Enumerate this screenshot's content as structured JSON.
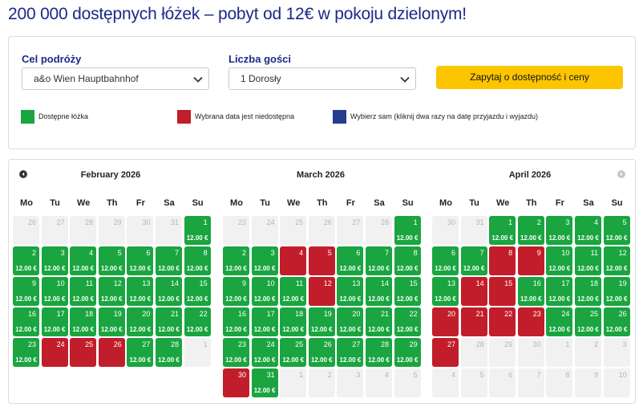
{
  "headline": "200 000 dostępnych łóżek – pobyt od 12€ w pokoju dzielonym!",
  "form": {
    "destination_label": "Cel podróży",
    "destination_value": "a&o Wien Hauptbahnhof",
    "guests_label": "Liczba gości",
    "guests_value": "1 Dorosły",
    "cta_label": "Zapytaj o dostępność i ceny"
  },
  "legend": [
    {
      "label": "Dostępne łóżka",
      "color": "#1aa540"
    },
    {
      "label": "Wybrana data jest niedostępna",
      "color": "#c21d2a"
    },
    {
      "label": "Wybierz sam (kliknij dwa razy na datę przyjazdu i wyjazdu)",
      "color": "#253c8f"
    }
  ],
  "colors": {
    "available": "#1aa540",
    "unavailable": "#c21d2a",
    "disabled": "#f1f1f1",
    "accent": "#1a2a88",
    "cta": "#fcc500"
  },
  "icons": {
    "prev": "chevron-left-icon",
    "next": "chevron-right-icon",
    "dropdown": "chevron-down-icon"
  },
  "weekdays": [
    "Mo",
    "Tu",
    "We",
    "Th",
    "Fr",
    "Sa",
    "Su"
  ],
  "price": "12.00 €",
  "months": [
    {
      "title": "February 2026",
      "cells": [
        {
          "d": "26",
          "s": "x"
        },
        {
          "d": "27",
          "s": "x"
        },
        {
          "d": "28",
          "s": "x"
        },
        {
          "d": "29",
          "s": "x"
        },
        {
          "d": "30",
          "s": "x"
        },
        {
          "d": "31",
          "s": "x"
        },
        {
          "d": "1",
          "s": "g"
        },
        {
          "d": "2",
          "s": "g"
        },
        {
          "d": "3",
          "s": "g"
        },
        {
          "d": "4",
          "s": "g"
        },
        {
          "d": "5",
          "s": "g"
        },
        {
          "d": "6",
          "s": "g"
        },
        {
          "d": "7",
          "s": "g"
        },
        {
          "d": "8",
          "s": "g"
        },
        {
          "d": "9",
          "s": "g"
        },
        {
          "d": "10",
          "s": "g"
        },
        {
          "d": "11",
          "s": "g"
        },
        {
          "d": "12",
          "s": "g"
        },
        {
          "d": "13",
          "s": "g"
        },
        {
          "d": "14",
          "s": "g"
        },
        {
          "d": "15",
          "s": "g"
        },
        {
          "d": "16",
          "s": "g"
        },
        {
          "d": "17",
          "s": "g"
        },
        {
          "d": "18",
          "s": "g"
        },
        {
          "d": "19",
          "s": "g"
        },
        {
          "d": "20",
          "s": "g"
        },
        {
          "d": "21",
          "s": "g"
        },
        {
          "d": "22",
          "s": "g"
        },
        {
          "d": "23",
          "s": "g"
        },
        {
          "d": "24",
          "s": "r"
        },
        {
          "d": "25",
          "s": "r"
        },
        {
          "d": "26",
          "s": "r"
        },
        {
          "d": "27",
          "s": "g"
        },
        {
          "d": "28",
          "s": "g"
        },
        {
          "d": "1",
          "s": "x"
        }
      ]
    },
    {
      "title": "March 2026",
      "cells": [
        {
          "d": "23",
          "s": "x"
        },
        {
          "d": "24",
          "s": "x"
        },
        {
          "d": "25",
          "s": "x"
        },
        {
          "d": "26",
          "s": "x"
        },
        {
          "d": "27",
          "s": "x"
        },
        {
          "d": "28",
          "s": "x"
        },
        {
          "d": "1",
          "s": "g"
        },
        {
          "d": "2",
          "s": "g"
        },
        {
          "d": "3",
          "s": "g"
        },
        {
          "d": "4",
          "s": "r"
        },
        {
          "d": "5",
          "s": "r"
        },
        {
          "d": "6",
          "s": "g"
        },
        {
          "d": "7",
          "s": "g"
        },
        {
          "d": "8",
          "s": "g"
        },
        {
          "d": "9",
          "s": "g"
        },
        {
          "d": "10",
          "s": "g"
        },
        {
          "d": "11",
          "s": "g"
        },
        {
          "d": "12",
          "s": "r"
        },
        {
          "d": "13",
          "s": "g"
        },
        {
          "d": "14",
          "s": "g"
        },
        {
          "d": "15",
          "s": "g"
        },
        {
          "d": "16",
          "s": "g"
        },
        {
          "d": "17",
          "s": "g"
        },
        {
          "d": "18",
          "s": "g"
        },
        {
          "d": "19",
          "s": "g"
        },
        {
          "d": "20",
          "s": "g"
        },
        {
          "d": "21",
          "s": "g"
        },
        {
          "d": "22",
          "s": "g"
        },
        {
          "d": "23",
          "s": "g"
        },
        {
          "d": "24",
          "s": "g"
        },
        {
          "d": "25",
          "s": "g"
        },
        {
          "d": "26",
          "s": "g"
        },
        {
          "d": "27",
          "s": "g"
        },
        {
          "d": "28",
          "s": "g"
        },
        {
          "d": "29",
          "s": "g"
        },
        {
          "d": "30",
          "s": "r"
        },
        {
          "d": "31",
          "s": "g"
        },
        {
          "d": "1",
          "s": "x"
        },
        {
          "d": "2",
          "s": "x"
        },
        {
          "d": "3",
          "s": "x"
        },
        {
          "d": "4",
          "s": "x"
        },
        {
          "d": "5",
          "s": "x"
        }
      ]
    },
    {
      "title": "April 2026",
      "cells": [
        {
          "d": "30",
          "s": "x"
        },
        {
          "d": "31",
          "s": "x"
        },
        {
          "d": "1",
          "s": "g"
        },
        {
          "d": "2",
          "s": "g"
        },
        {
          "d": "3",
          "s": "g"
        },
        {
          "d": "4",
          "s": "g"
        },
        {
          "d": "5",
          "s": "g"
        },
        {
          "d": "6",
          "s": "g"
        },
        {
          "d": "7",
          "s": "g"
        },
        {
          "d": "8",
          "s": "r"
        },
        {
          "d": "9",
          "s": "r"
        },
        {
          "d": "10",
          "s": "g"
        },
        {
          "d": "11",
          "s": "g"
        },
        {
          "d": "12",
          "s": "g"
        },
        {
          "d": "13",
          "s": "g"
        },
        {
          "d": "14",
          "s": "r"
        },
        {
          "d": "15",
          "s": "r"
        },
        {
          "d": "16",
          "s": "g"
        },
        {
          "d": "17",
          "s": "g"
        },
        {
          "d": "18",
          "s": "g"
        },
        {
          "d": "19",
          "s": "g"
        },
        {
          "d": "20",
          "s": "r"
        },
        {
          "d": "21",
          "s": "r"
        },
        {
          "d": "22",
          "s": "r"
        },
        {
          "d": "23",
          "s": "r"
        },
        {
          "d": "24",
          "s": "g"
        },
        {
          "d": "25",
          "s": "g"
        },
        {
          "d": "26",
          "s": "g"
        },
        {
          "d": "27",
          "s": "r"
        },
        {
          "d": "28",
          "s": "x"
        },
        {
          "d": "29",
          "s": "x"
        },
        {
          "d": "30",
          "s": "x"
        },
        {
          "d": "1",
          "s": "x"
        },
        {
          "d": "2",
          "s": "x"
        },
        {
          "d": "3",
          "s": "x"
        },
        {
          "d": "4",
          "s": "x"
        },
        {
          "d": "5",
          "s": "x"
        },
        {
          "d": "6",
          "s": "x"
        },
        {
          "d": "7",
          "s": "x"
        },
        {
          "d": "8",
          "s": "x"
        },
        {
          "d": "9",
          "s": "x"
        },
        {
          "d": "10",
          "s": "x"
        }
      ]
    }
  ]
}
